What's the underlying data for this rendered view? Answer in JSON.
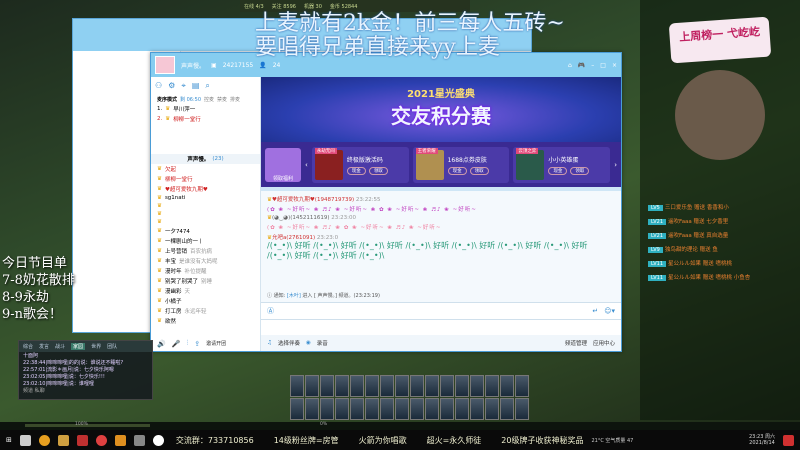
{
  "top_strip": {
    "items": [
      "在线 4/3",
      "关注 8596",
      "机器 30",
      "金币 52844"
    ]
  },
  "overlay": {
    "line1": "上麦就有2k金！前三每人五砖~",
    "line2": "要唱得兄弟直接来yy上麦"
  },
  "schedule": {
    "title": "今日节目单",
    "items": [
      "7-8奶花散排",
      "8-9永劫",
      "9-n歌会！"
    ]
  },
  "yy_window": {
    "channel_name": "声声慢。",
    "channel_id": "24217155",
    "online_count": "24",
    "mode_label": "麦序模式",
    "timer": "剩 06:50",
    "mode_actions": [
      "控麦",
      "禁麦",
      "排麦"
    ],
    "queue": [
      {
        "index": "1.",
        "name": "早川萍一"
      },
      {
        "index": "2.",
        "name": "柳柳一堂行"
      }
    ],
    "member_header": "声声慢。",
    "member_count": "(23)",
    "members": [
      "欠起",
      "柳柳一堂行",
      "♥超可爱牧九期♥",
      "sg1nati",
      "",
      "",
      "",
      "一夕7474",
      "一棵剧山的一丨",
      "上号营销",
      "丰宝",
      "漫时年",
      "别哭了别哭了",
      "漫幽彩",
      "小橘子",
      "打工房",
      "欲然"
    ],
    "member_notes": [
      "",
      "",
      "",
      "",
      "",
      "",
      "",
      "",
      "",
      "百农抗病",
      "是谁没有大妈呢",
      "补位提醒",
      "别睡",
      "天",
      "",
      "永远年轻",
      ""
    ],
    "banner": {
      "title": "2021星光盛典",
      "subtitle": "交友积分赛"
    },
    "gift_promo": "领取福利",
    "gifts": [
      {
        "tag": "永劫无间",
        "name": "终极版激活码",
        "b1": "现金",
        "b2": "领取"
      },
      {
        "tag": "王者荣耀",
        "name": "1688点券皮肤",
        "b1": "现金",
        "b2": "领取"
      },
      {
        "tag": "云顶之弈",
        "name": "小小英雄蛋",
        "b1": "现金",
        "b2": "领取"
      }
    ],
    "messages": [
      {
        "name": "♥超可爱牧九期♥(1948719739)",
        "time": "23:22:55",
        "content": "(✿ ❀ ~好听~ ❀ ♬♪ ❀ ~好听~ ❀ ✿ ❀ ~好听~ ❀ ♬♪ ❀ ~好听~"
      },
      {
        "name": "(◕‿◕)(1452111619)",
        "time": "23:23:00",
        "content": "(✿ ❀ ~好听~ ❀ ♬♪ ❀ ✿ ❀ ~好听~ ❀ ♬♪ ❀ ~好听~"
      },
      {
        "name": "允吧a(2761091)",
        "time": "23:23:0",
        "content": "/(•_•)\\ 好听 /(•_•)\\ 好听 /(•_•)\\ 好听 /(•_•)\\ 好听 /(•_•)\\ 好听 /(•_•)\\ 好听 /(•_•)\\ 好听 /(•_•)\\ 好听 /(•_•)\\ 好听 /(•_•)\\"
      }
    ],
    "status": {
      "label": "通知:",
      "user": "[木叶]",
      "action": "进入 [",
      "channel": "声声慢。] 频道。(23:23:19)"
    },
    "bottom": {
      "accompany": "选择伴奏",
      "record": "录音",
      "manage": "频道管理",
      "apps": "应用中心",
      "invite": "邀请开团"
    }
  },
  "left_chat": {
    "tabs": [
      "综合",
      "发言",
      "战斗",
      "家园",
      "世界",
      "团队"
    ],
    "lines": [
      "十面阿",
      "22:38:44|啼啼啼哩|的的|说：谁说还不睡啦?",
      "22:57:01|流影＊画月|说：七夕快乐阿嗯",
      "23:02:05|啼啼啼哩|说：七夕快乐!!!",
      "23:02:10|啼啼啼哩|说：谁哩哩"
    ],
    "footer": "频道 私聊"
  },
  "right_panel": {
    "banner": "上周榜一 弋屹屹",
    "items": [
      {
        "badge": "LV5",
        "text": "三口爱乐鱼 赠送 香香和小"
      },
      {
        "badge": "LV21",
        "text": "遥吹Faaa 赠送 七夕香里"
      },
      {
        "badge": "LV21",
        "text": "遥吹Faaa 赠送 真自选量"
      },
      {
        "badge": "LV9",
        "text": "独鸟甜的理论 赠送 鱼"
      },
      {
        "badge": "LV11",
        "text": "星公ルル如果 赠送 嗜桃桃"
      },
      {
        "badge": "LV11",
        "text": "星公ルル如果 赠送 嗜桃桃 小鱼杏"
      }
    ]
  },
  "progress": {
    "left_label": "100%",
    "right_label": "0%",
    "left_value": 100,
    "right_value": 0
  },
  "taskbar": {
    "marquee": [
      "交流群：733710856",
      "14级粉丝牌=房管",
      "火箭为你唱歌",
      "超火=永久师徒",
      "20级牌子收获神秘奖品"
    ],
    "weather": "21°C 空气质量 47",
    "time": "23:23 周六",
    "date": "2021/8/14"
  }
}
